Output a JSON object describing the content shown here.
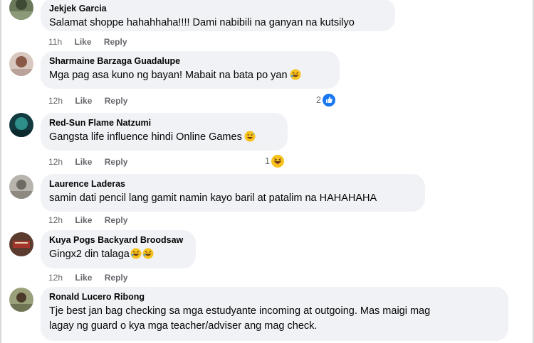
{
  "comments": [
    {
      "author": "Jekjek Garcia",
      "text": "Salamat shoppe hahahhaha!!!! Dami nabibili na ganyan na kutsilyo",
      "time": "11h",
      "like": "Like",
      "reply": "Reply"
    },
    {
      "author": "Sharmaine Barzaga Guadalupe",
      "text": "Mga pag asa kuno ng bayan! Mabait na bata po yan",
      "emoji": "rofl-emoji",
      "time": "12h",
      "like": "Like",
      "reply": "Reply",
      "reaction_count": "2",
      "reaction_icon": "like-reaction-icon"
    },
    {
      "author": "Red-Sun Flame Natzumi",
      "text": "Gangsta life influence hindi Online Games",
      "emoji": "grinning-sweat-emoji",
      "time": "12h",
      "like": "Like",
      "reply": "Reply",
      "reaction_count": "1",
      "reaction_icon": "haha-reaction-icon"
    },
    {
      "author": "Laurence Laderas",
      "text": "samin dati pencil lang gamit namin kayo baril at patalim na HAHAHAHA",
      "time": "12h",
      "like": "Like",
      "reply": "Reply"
    },
    {
      "author": "Kuya Pogs Backyard Broodsaw",
      "text": "Gingx2 din talaga",
      "emoji": "rofl-emoji x2",
      "time": "12h",
      "like": "Like",
      "reply": "Reply"
    },
    {
      "author": "Ronald Lucero Ribong",
      "text_line1": "Tje best jan bag checking sa mga estudyante incoming at outgoing. Mas maigi mag",
      "text_line2": "lagay ng guard o kya mga teacher/adviser ang mag check."
    }
  ],
  "colors": {
    "bubble": "#f0f2f5",
    "meta": "#65676b",
    "like_blue": "#1877f2"
  }
}
